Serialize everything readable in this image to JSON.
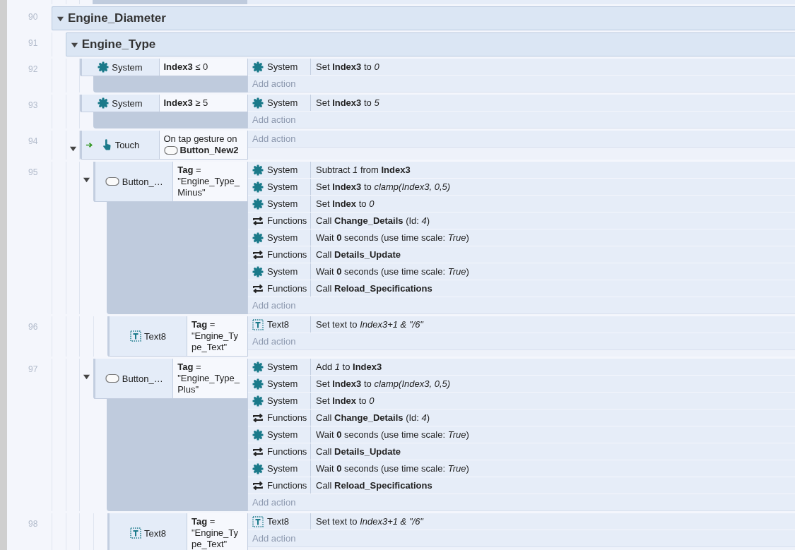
{
  "events": [
    {
      "line": "90",
      "kind": "group",
      "title": "Engine_Diameter",
      "expanded": true,
      "children": [
        {
          "line": "91",
          "kind": "group",
          "title": "Engine_Type",
          "expanded": true,
          "children": [
            {
              "line": "92",
              "kind": "event",
              "condition": {
                "object": "System",
                "kind": "system",
                "text": "**Index3** ≤ 0"
              },
              "actions": [
                {
                  "object": "System",
                  "kind": "system",
                  "text": "Set **Index3** to *0*"
                }
              ],
              "add_action": "Add action"
            },
            {
              "line": "93",
              "kind": "event",
              "condition": {
                "object": "System",
                "kind": "system",
                "text": "**Index3** ≥ 5"
              },
              "actions": [
                {
                  "object": "System",
                  "kind": "system",
                  "text": "Set **Index3** to *5*"
                }
              ],
              "add_action": "Add action"
            },
            {
              "line": "94",
              "kind": "event",
              "trigger": true,
              "expanded": true,
              "condition": {
                "object": "Touch",
                "kind": "touch",
                "text": "On tap gesture on",
                "target": {
                  "kind": "button",
                  "name": "Button_New2"
                }
              },
              "add_action": "Add action",
              "children": [
                {
                  "line": "95",
                  "kind": "event",
                  "expanded": true,
                  "condition": {
                    "object": "Button_…",
                    "kind": "button",
                    "text": "**Tag** = \"Engine_Type_Minus\""
                  },
                  "actions": [
                    {
                      "object": "System",
                      "kind": "system",
                      "text": "Subtract *1* from **Index3**"
                    },
                    {
                      "object": "System",
                      "kind": "system",
                      "text": "Set **Index3** to *clamp(Index3, 0,5)*"
                    },
                    {
                      "object": "System",
                      "kind": "system",
                      "text": "Set **Index** to *0*"
                    },
                    {
                      "object": "Functions",
                      "kind": "functions",
                      "text": "Call **Change_Details** (Id: *4*)"
                    },
                    {
                      "object": "System",
                      "kind": "system",
                      "text": "Wait **0** seconds (use time scale: *True*)"
                    },
                    {
                      "object": "Functions",
                      "kind": "functions",
                      "text": "Call **Details_Update**"
                    },
                    {
                      "object": "System",
                      "kind": "system",
                      "text": "Wait **0** seconds (use time scale: *True*)"
                    },
                    {
                      "object": "Functions",
                      "kind": "functions",
                      "text": "Call **Reload_Specifications**"
                    }
                  ],
                  "add_action": "Add action",
                  "children": [
                    {
                      "line": "96",
                      "kind": "event",
                      "condition": {
                        "object": "Text8",
                        "kind": "text",
                        "text": "**Tag** = \"Engine_Type_Text\""
                      },
                      "actions": [
                        {
                          "object": "Text8",
                          "kind": "text",
                          "text": "Set text to *Index3+1 & \"/6\"*"
                        }
                      ],
                      "add_action": "Add action"
                    }
                  ]
                },
                {
                  "line": "97",
                  "kind": "event",
                  "expanded": true,
                  "condition": {
                    "object": "Button_…",
                    "kind": "button",
                    "text": "**Tag** = \"Engine_Type_Plus\""
                  },
                  "actions": [
                    {
                      "object": "System",
                      "kind": "system",
                      "text": "Add *1* to **Index3**"
                    },
                    {
                      "object": "System",
                      "kind": "system",
                      "text": "Set **Index3** to *clamp(Index3, 0,5)*"
                    },
                    {
                      "object": "System",
                      "kind": "system",
                      "text": "Set **Index** to *0*"
                    },
                    {
                      "object": "Functions",
                      "kind": "functions",
                      "text": "Call **Change_Details** (Id: *4*)"
                    },
                    {
                      "object": "System",
                      "kind": "system",
                      "text": "Wait **0** seconds (use time scale: *True*)"
                    },
                    {
                      "object": "Functions",
                      "kind": "functions",
                      "text": "Call **Details_Update**"
                    },
                    {
                      "object": "System",
                      "kind": "system",
                      "text": "Wait **0** seconds (use time scale: *True*)"
                    },
                    {
                      "object": "Functions",
                      "kind": "functions",
                      "text": "Call **Reload_Specifications**"
                    }
                  ],
                  "add_action": "Add action",
                  "children": [
                    {
                      "line": "98",
                      "kind": "event",
                      "condition": {
                        "object": "Text8",
                        "kind": "text",
                        "text": "**Tag** = \"Engine_Type_Text\""
                      },
                      "actions": [
                        {
                          "object": "Text8",
                          "kind": "text",
                          "text": "Set text to *Index3+1 & \"/6\"*"
                        }
                      ],
                      "add_action": "Add action"
                    }
                  ]
                }
              ]
            }
          ]
        }
      ]
    }
  ]
}
